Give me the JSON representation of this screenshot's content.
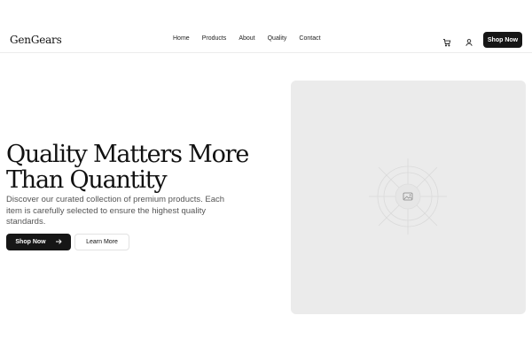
{
  "header": {
    "logo": "GenGears",
    "nav": [
      "Home",
      "Products",
      "About",
      "Quality",
      "Contact"
    ],
    "cart_icon": "cart-icon",
    "user_icon": "user-icon",
    "cta_label": "Shop Now"
  },
  "hero": {
    "title": "Quality Matters More Than Quantity",
    "description": "Discover our curated collection of premium products. Each item is carefully selected to ensure the highest quality standards.",
    "primary_label": "Shop Now",
    "primary_icon": "arrow-right-icon",
    "secondary_label": "Learn More",
    "image_icon": "image-placeholder-icon"
  },
  "colors": {
    "accent": "#161616",
    "placeholder": "#ebebeb",
    "text_muted": "#555555"
  }
}
